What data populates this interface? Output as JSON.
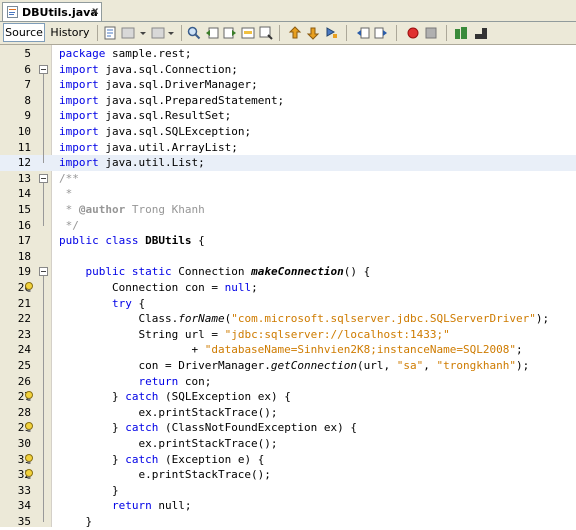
{
  "tab": {
    "title": "DBUtils.java",
    "close": "x"
  },
  "toolbar": {
    "source_label": "Source",
    "history_label": "History"
  },
  "code": [
    {
      "num": "5",
      "text": "package sample.rest;"
    },
    {
      "num": "6",
      "text": "import java.sql.Connection;"
    },
    {
      "num": "7",
      "text": "import java.sql.DriverManager;"
    },
    {
      "num": "8",
      "text": "import java.sql.PreparedStatement;"
    },
    {
      "num": "9",
      "text": "import java.sql.ResultSet;"
    },
    {
      "num": "10",
      "text": "import java.sql.SQLException;"
    },
    {
      "num": "11",
      "text": "import java.util.ArrayList;"
    },
    {
      "num": "12",
      "text": "import java.util.List;"
    },
    {
      "num": "13",
      "text": "/**"
    },
    {
      "num": "14",
      "text": " *"
    },
    {
      "num": "15",
      "text": " * @author Trong Khanh"
    },
    {
      "num": "16",
      "text": " */"
    },
    {
      "num": "17",
      "text": "public class DBUtils {"
    },
    {
      "num": "18",
      "text": ""
    },
    {
      "num": "19",
      "text": "    public static Connection makeConnection() {"
    },
    {
      "num": "20",
      "text": "        Connection con = null;"
    },
    {
      "num": "21",
      "text": "        try {"
    },
    {
      "num": "22",
      "text": "            Class.forName(\"com.microsoft.sqlserver.jdbc.SQLServerDriver\");"
    },
    {
      "num": "23",
      "text": "            String url = \"jdbc:sqlserver://localhost:1433;\""
    },
    {
      "num": "24",
      "text": "                    + \"databaseName=Sinhvien2K8;instanceName=SQL2008\";"
    },
    {
      "num": "25",
      "text": "            con = DriverManager.getConnection(url, \"sa\", \"trongkhanh\");"
    },
    {
      "num": "26",
      "text": "            return con;"
    },
    {
      "num": "27",
      "text": "        } catch (SQLException ex) {"
    },
    {
      "num": "28",
      "text": "            ex.printStackTrace();"
    },
    {
      "num": "29",
      "text": "        } catch (ClassNotFoundException ex) {"
    },
    {
      "num": "30",
      "text": "            ex.printStackTrace();"
    },
    {
      "num": "31",
      "text": "        } catch (Exception e) {"
    },
    {
      "num": "32",
      "text": "            e.printStackTrace();"
    },
    {
      "num": "33",
      "text": "        }"
    },
    {
      "num": "34",
      "text": "        return null;"
    },
    {
      "num": "35",
      "text": "    }"
    }
  ],
  "tokens": {
    "5": [
      [
        "kw",
        "package"
      ],
      [
        "",
        "sample.rest;"
      ]
    ],
    "6": [
      [
        "kw",
        "import"
      ],
      [
        "",
        "java.sql.Connection;"
      ]
    ],
    "7": [
      [
        "kw",
        "import"
      ],
      [
        "",
        "java.sql.DriverManager;"
      ]
    ],
    "8": [
      [
        "kw",
        "import"
      ],
      [
        "",
        "java.sql.PreparedStatement;"
      ]
    ],
    "9": [
      [
        "kw",
        "import"
      ],
      [
        "",
        "java.sql.ResultSet;"
      ]
    ],
    "10": [
      [
        "kw",
        "import"
      ],
      [
        "",
        "java.sql.SQLException;"
      ]
    ],
    "11": [
      [
        "kw",
        "import"
      ],
      [
        "",
        "java.util.ArrayList;"
      ]
    ],
    "12": [
      [
        "kw",
        "import"
      ],
      [
        "",
        "java.util.List;"
      ]
    ],
    "13": [
      [
        "cmt",
        "/**"
      ]
    ],
    "14": [
      [
        "cmt",
        " *"
      ]
    ],
    "15": [
      [
        "cmt",
        " * "
      ],
      [
        "cmtb",
        "@author"
      ],
      [
        "cmt",
        " Trong Khanh"
      ]
    ],
    "16": [
      [
        "cmt",
        " */"
      ]
    ],
    "17": [
      [
        "kw",
        "public class"
      ],
      [
        "cls",
        "DBUtils"
      ],
      [
        "",
        "{"
      ]
    ],
    "18": [],
    "19": [
      [
        "",
        "    "
      ],
      [
        "kw",
        "public static"
      ],
      [
        "",
        "Connection"
      ],
      [
        "meth",
        "makeConnection"
      ],
      [
        "",
        "() {"
      ]
    ],
    "20": [
      [
        "",
        "        Connection con = "
      ],
      [
        "kw",
        "null"
      ],
      [
        "",
        ";"
      ]
    ],
    "21": [
      [
        "",
        "        "
      ],
      [
        "kw",
        "try"
      ],
      [
        "",
        "{"
      ]
    ],
    "22": [
      [
        "",
        "            Class."
      ],
      [
        "smeth",
        "forName"
      ],
      [
        "",
        "("
      ],
      [
        "str",
        "\"com.microsoft.sqlserver.jdbc.SQLServerDriver\""
      ],
      [
        "",
        ");"
      ]
    ],
    "23": [
      [
        "",
        "            String url = "
      ],
      [
        "str",
        "\"jdbc:sqlserver://localhost:1433;\""
      ]
    ],
    "24": [
      [
        "",
        "                    + "
      ],
      [
        "str",
        "\"databaseName=Sinhvien2K8;instanceName=SQL2008\""
      ],
      [
        "",
        ";"
      ]
    ],
    "25": [
      [
        "",
        "            con = DriverManager."
      ],
      [
        "smeth",
        "getConnection"
      ],
      [
        "",
        "(url, "
      ],
      [
        "str",
        "\"sa\""
      ],
      [
        "",
        ", "
      ],
      [
        "str",
        "\"trongkhanh\""
      ],
      [
        "",
        ");"
      ]
    ],
    "26": [
      [
        "",
        "            "
      ],
      [
        "kw",
        "return"
      ],
      [
        "",
        "con;"
      ]
    ],
    "27": [
      [
        "",
        "        } "
      ],
      [
        "kw",
        "catch"
      ],
      [
        "",
        "(SQLException ex) {"
      ]
    ],
    "28": [
      [
        "",
        "            ex.printStackTrace();"
      ]
    ],
    "29": [
      [
        "",
        "        } "
      ],
      [
        "kw",
        "catch"
      ],
      [
        "",
        "(ClassNotFoundException ex) {"
      ]
    ],
    "30": [
      [
        "",
        "            ex.printStackTrace();"
      ]
    ],
    "31": [
      [
        "",
        "        } "
      ],
      [
        "kw",
        "catch"
      ],
      [
        "",
        "(Exception e) {"
      ]
    ],
    "32": [
      [
        "",
        "            e.printStackTrace();"
      ]
    ],
    "33": [
      [
        "",
        "        }"
      ]
    ],
    "34": [
      [
        "",
        "        "
      ],
      [
        "kw",
        "return"
      ],
      [
        "",
        "null;"
      ]
    ],
    "35": [
      [
        "",
        "    }"
      ]
    ]
  },
  "hint_lines": [
    "20",
    "27",
    "29",
    "31",
    "32"
  ],
  "fold_lines": [
    "6",
    "13",
    "19"
  ],
  "highlight_line": "12",
  "colors": {
    "keyword": "#0000e6",
    "string": "#ce7b00",
    "comment": "#969696",
    "current_line": "#e9eff8",
    "toolbar_bg": "#ece9d8"
  }
}
